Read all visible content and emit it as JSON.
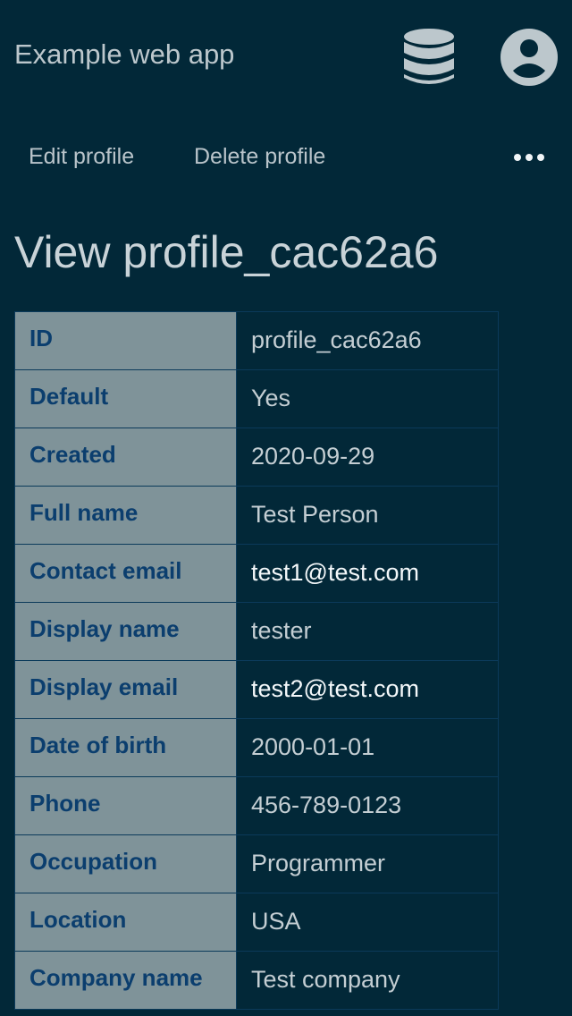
{
  "header": {
    "app_title": "Example web app"
  },
  "actions": {
    "edit_label": "Edit profile",
    "delete_label": "Delete profile",
    "more_icon": "more-horizontal-icon"
  },
  "page": {
    "title": "View profile_cac62a6"
  },
  "profile": {
    "rows": [
      {
        "label": "ID",
        "value": "profile_cac62a6"
      },
      {
        "label": "Default",
        "value": "Yes"
      },
      {
        "label": "Created",
        "value": "2020-09-29"
      },
      {
        "label": "Full name",
        "value": "Test Person"
      },
      {
        "label": "Contact email",
        "value": "test1@test.com"
      },
      {
        "label": "Display name",
        "value": "tester"
      },
      {
        "label": "Display email",
        "value": "test2@test.com"
      },
      {
        "label": "Date of birth",
        "value": "2000-01-01"
      },
      {
        "label": "Phone",
        "value": "456-789-0123"
      },
      {
        "label": "Occupation",
        "value": "Programmer"
      },
      {
        "label": "Location",
        "value": "USA"
      },
      {
        "label": "Company name",
        "value": "Test company"
      }
    ]
  },
  "colors": {
    "background": "#022838",
    "label_column": "#7f9399",
    "label_text": "#0b3e6e",
    "value_text": "#c4ced3",
    "link_text": "#f4f8fa"
  }
}
